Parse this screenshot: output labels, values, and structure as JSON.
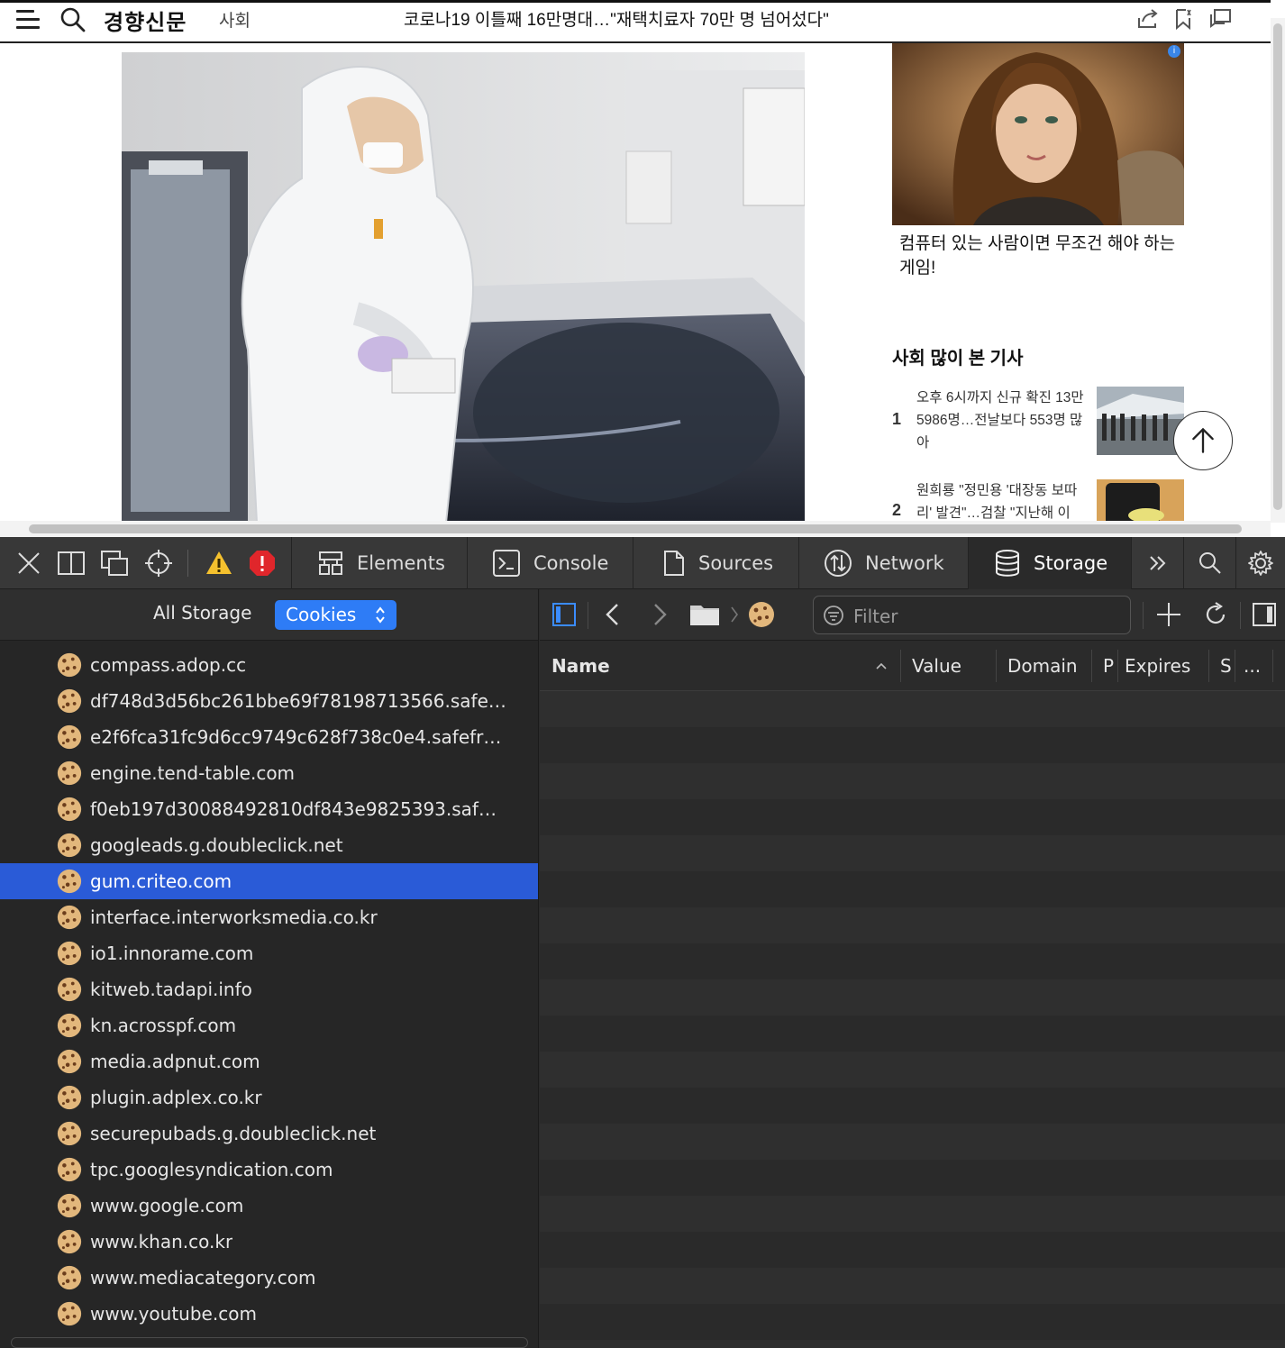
{
  "site": {
    "logo": "경향신문",
    "section": "사회",
    "headline": "코로나19 이틀째 16만명대…\"재택치료자 70만 명 넘어섰다\""
  },
  "ad": {
    "badge": "i",
    "caption": "컴퓨터 있는 사람이면 무조건 해야 하는 게임!"
  },
  "popular": {
    "title": "사회 많이 본 기사",
    "items": [
      {
        "rank": "1",
        "text": "오후 6시까지 신규 확진 13만5986명…전날보다 553명 많아"
      },
      {
        "rank": "2",
        "text": "원희룡 \"정민용 '대장동 보따리' 발견\"…검찰 \"지난해 이"
      }
    ]
  },
  "devtools": {
    "tabs": [
      "Elements",
      "Console",
      "Sources",
      "Network",
      "Storage"
    ],
    "selected_tab": "Storage",
    "storage": {
      "all_storage_label": "All Storage",
      "scope_selector": "Cookies",
      "selected_domain": "gum.criteo.com",
      "domains": [
        "compass.adop.cc",
        "df748d3d56bc261bbe69f78198713566.safe…",
        "e2f6fca31fc9d6cc9749c628f738c0e4.safefr…",
        "engine.tend-table.com",
        "f0eb197d30088492810df843e9825393.saf…",
        "googleads.g.doubleclick.net",
        "gum.criteo.com",
        "interface.interworksmedia.co.kr",
        "io1.innorame.com",
        "kitweb.tadapi.info",
        "kn.acrosspf.com",
        "media.adpnut.com",
        "plugin.adplex.co.kr",
        "securepubads.g.doubleclick.net",
        "tpc.googlesyndication.com",
        "www.google.com",
        "www.khan.co.kr",
        "www.mediacategory.com",
        "www.youtube.com"
      ],
      "filter_placeholder": "Filter",
      "columns": {
        "name": "Name",
        "value": "Value",
        "domain": "Domain",
        "path": "P",
        "expires": "Expires",
        "size": "S",
        "more": "..."
      }
    },
    "colors": {
      "selection": "#2a5bd7",
      "scope_button": "#2e7cf6",
      "warning": "#f5c12e",
      "error": "#e0262b"
    }
  }
}
